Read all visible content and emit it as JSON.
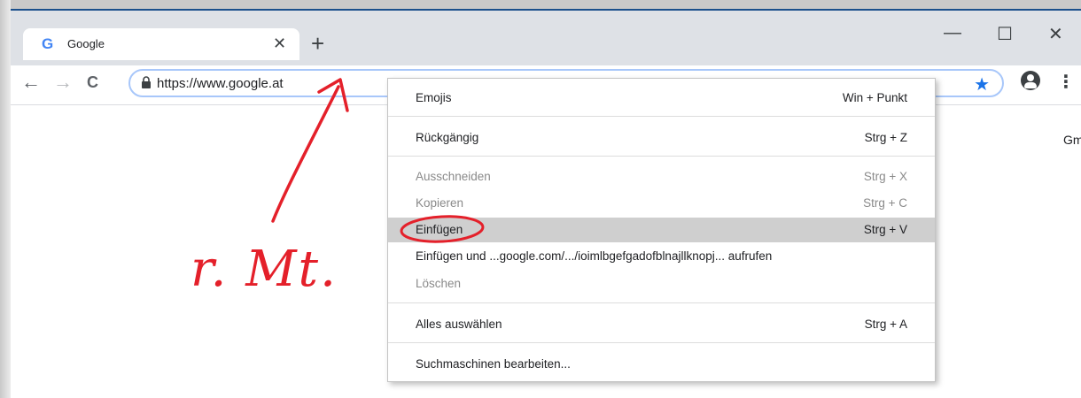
{
  "tab": {
    "favicon": "G",
    "title": "Google",
    "close": "✕"
  },
  "newtab": "+",
  "window": {
    "minimize": "—",
    "maximize": "☐",
    "close": "✕"
  },
  "nav": {
    "back": "←",
    "forward": "→",
    "reload": "C"
  },
  "omnibox": {
    "url": "https://www.google.at",
    "star": "★"
  },
  "page": {
    "gmail_partial": "Gm"
  },
  "menu_dots": "⋮",
  "context_menu": {
    "items": [
      {
        "label": "Emojis",
        "shortcut": "Win + Punkt"
      },
      {
        "label": "Rückgängig",
        "shortcut": "Strg + Z"
      },
      {
        "label": "Ausschneiden",
        "shortcut": "Strg + X"
      },
      {
        "label": "Kopieren",
        "shortcut": "Strg + C"
      },
      {
        "label": "Einfügen",
        "shortcut": "Strg + V"
      },
      {
        "label": "Einfügen und ...google.com/.../ioimlbgefgadofblnajllknopj... aufrufen",
        "shortcut": ""
      },
      {
        "label": "Löschen",
        "shortcut": ""
      },
      {
        "label": "Alles auswählen",
        "shortcut": "Strg + A"
      },
      {
        "label": "Suchmaschinen bearbeiten...",
        "shortcut": ""
      }
    ]
  },
  "annotation": {
    "text": "r. Mt.",
    "color": "#e4202a"
  },
  "colors": {
    "accent": "#1a73e8",
    "highlight": "#cfcfcf",
    "tabstrip": "#dee1e6"
  }
}
